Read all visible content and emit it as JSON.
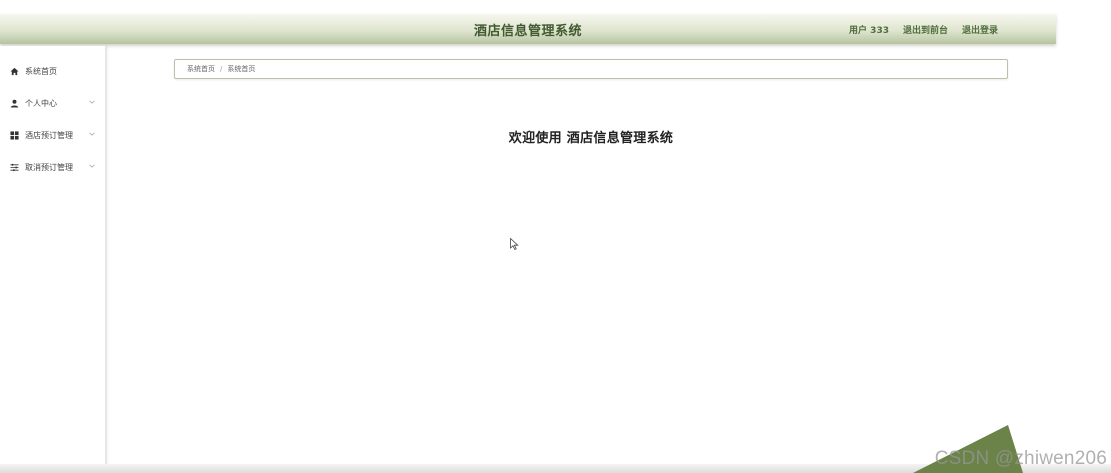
{
  "header": {
    "title": "酒店信息管理系统",
    "user": "用户 333",
    "exit_front": "退出到前台",
    "logout": "退出登录"
  },
  "sidebar": {
    "items": [
      {
        "label": "系统首页",
        "icon": "home-icon",
        "expandable": false
      },
      {
        "label": "个人中心",
        "icon": "user-icon",
        "expandable": true
      },
      {
        "label": "酒店预订管理",
        "icon": "grid-icon",
        "expandable": true
      },
      {
        "label": "取消预订管理",
        "icon": "sliders-icon",
        "expandable": true
      }
    ]
  },
  "breadcrumb": {
    "items": [
      "系统首页",
      "系统首页"
    ],
    "separator": "/"
  },
  "main": {
    "welcome": "欢迎使用 酒店信息管理系统"
  },
  "watermark": "CSDN @zhiwen206",
  "colors": {
    "header_text": "#425a30",
    "accent": "#5f7a45",
    "corner": "#6b8248"
  }
}
